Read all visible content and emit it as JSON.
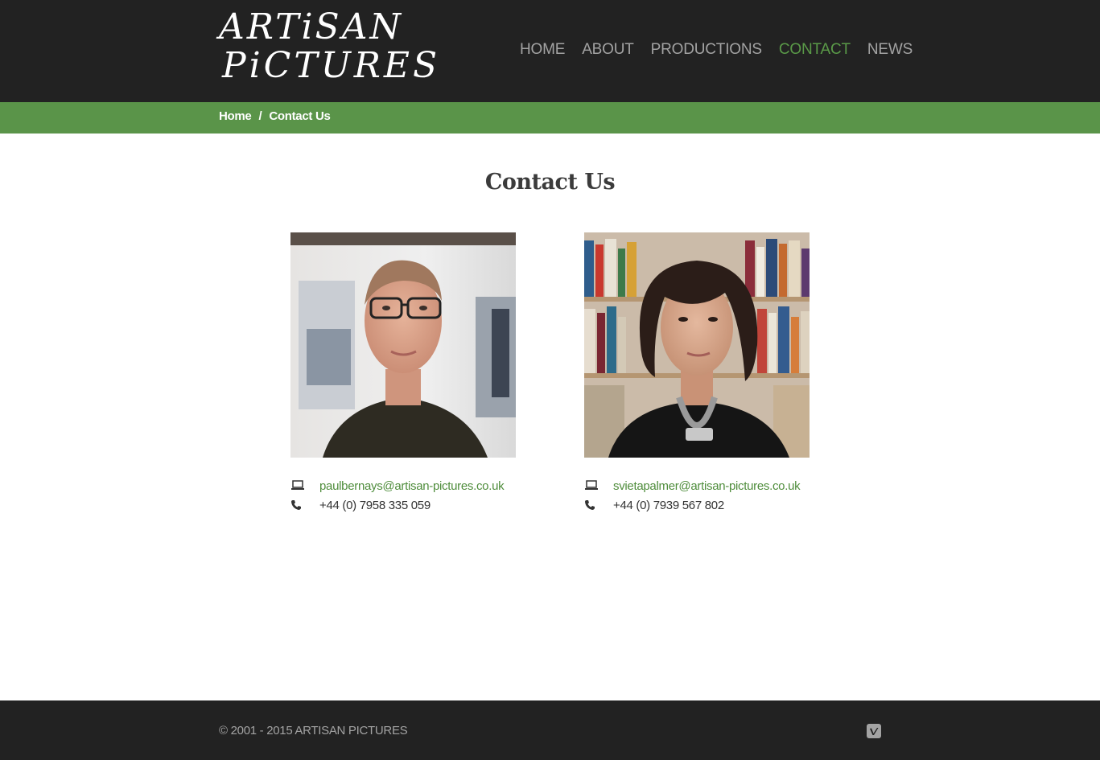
{
  "header": {
    "logo_line1": "ARTiSAN",
    "logo_line2": "PiCTURES",
    "nav": [
      {
        "label": "HOME"
      },
      {
        "label": "ABOUT"
      },
      {
        "label": "PRODUCTIONS"
      },
      {
        "label": "CONTACT",
        "active": true
      },
      {
        "label": "NEWS"
      }
    ],
    "active_color": "#5a9a48"
  },
  "breadcrumb": {
    "home": "Home",
    "separator": "/",
    "current": "Contact Us",
    "bar_color": "#5a9449"
  },
  "main": {
    "title": "Contact Us",
    "contacts": [
      {
        "email": "paulbernays@artisan-pictures.co.uk",
        "phone": "+44 (0) 7958 335 059",
        "email_icon": "laptop-icon",
        "phone_icon": "phone-icon"
      },
      {
        "email": "svietapalmer@artisan-pictures.co.uk",
        "phone": "+44 (0) 7939 567 802",
        "email_icon": "laptop-icon",
        "phone_icon": "phone-icon"
      }
    ]
  },
  "footer": {
    "copyright": "© 2001 - 2015 ARTISAN PICTURES",
    "social_icon": "vimeo-icon"
  }
}
